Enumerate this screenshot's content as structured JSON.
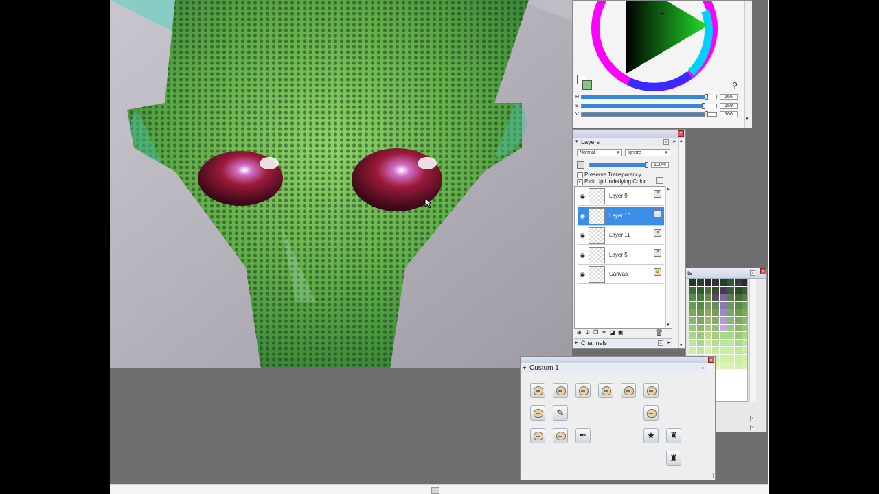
{
  "color_panel": {
    "labels": {
      "h": "H",
      "s": "S",
      "v": "V"
    },
    "values": {
      "h": "166",
      "s": "159",
      "v": "166"
    },
    "levels": {
      "h": 0.93,
      "s": 0.91,
      "v": 0.93
    },
    "primary_color": "#ffffff",
    "secondary_color": "#7fc97a"
  },
  "layers_panel": {
    "title": "Layers",
    "composite_method": "Normal",
    "composite_depth": "Ignore",
    "opacity": "100%",
    "opacity_level": 1.0,
    "preserve_transparency_label": "Preserve Transparency",
    "pick_up_color_label": "Pick Up Underlying Color",
    "preserve_transparency_checked": false,
    "pick_up_color_checked": true,
    "layers": [
      {
        "name": "Layer 9",
        "selected": false
      },
      {
        "name": "Layer 10",
        "selected": true
      },
      {
        "name": "Layer 11",
        "selected": false
      },
      {
        "name": "Layer 5",
        "selected": false
      },
      {
        "name": "Canvas",
        "selected": false
      }
    ],
    "channels_label": "Channels"
  },
  "swatches_panel": {
    "title_fragment": "ts",
    "colors": [
      "#1e3a24",
      "#22412b",
      "#2a2a2a",
      "#3b2a3a",
      "#25402a",
      "#2b5a35",
      "#3a3a3a",
      "#2a2a3a",
      "#3f6a3a",
      "#2f5a2f",
      "#4a6a3a",
      "#3a4a2a",
      "#4a3a5a",
      "#3a5a3a",
      "#2a4a2a",
      "#3a5a3a",
      "#5a8a4a",
      "#4a7a3a",
      "#6a8a4a",
      "#5a4a6a",
      "#7a6aa0",
      "#5a7a4a",
      "#4a6a3a",
      "#5a7a4a",
      "#6a9a4a",
      "#5a8a4a",
      "#7a9a5a",
      "#6a8a5a",
      "#8a7ab0",
      "#6a9a5a",
      "#5a8a4a",
      "#6a9a5a",
      "#7aa85a",
      "#6a9a4a",
      "#8aaa5a",
      "#7a9a5a",
      "#a08ac8",
      "#7aa85a",
      "#6a9a4a",
      "#7aa85a",
      "#8ab86a",
      "#7aa85a",
      "#9ab86a",
      "#8aaa6a",
      "#b09ad8",
      "#8ab86a",
      "#7aa85a",
      "#8ab86a",
      "#9ac87a",
      "#8ab86a",
      "#aac87a",
      "#9ab87a",
      "#c0aae0",
      "#9ac87a",
      "#8ab86a",
      "#9ac87a",
      "#aad88a",
      "#9ac87a",
      "#bad88a",
      "#aac88a",
      "#aad88a",
      "#aad88a",
      "#9ac87a",
      "#aad88a",
      "#bae89a",
      "#aad88a",
      "#c8e89a",
      "#bad89a",
      "#bae89a",
      "#bae89a",
      "#aad88a",
      "#bae89a",
      "#c8f0a0",
      "#bae89a",
      "#d0f0a8",
      "#c8e8a0",
      "#c8f0a0",
      "#c8f0a0",
      "#bae89a",
      "#c8f0a0",
      "#d0f0a8",
      "#c8f0a0",
      "#d8f4b0",
      "#d0f0a8",
      "#d0f0a8",
      "#d0f0a8",
      "#c8f0a0",
      "#d0f0a8",
      "#d8f4b0",
      "#d0f0a8",
      "#e0f8b8",
      "#d8f4b0",
      "#d8f4b0",
      "#d8f4b0",
      "#d0f0a8",
      "#d8f4b0"
    ]
  },
  "custom_palette": {
    "title": "Custom  1",
    "tools": [
      {
        "name": "brush-variant-1-icon",
        "glyph": ""
      },
      {
        "name": "brush-variant-2-icon",
        "glyph": ""
      },
      {
        "name": "brush-variant-3-icon",
        "glyph": ""
      },
      {
        "name": "brush-variant-4-icon",
        "glyph": ""
      },
      {
        "name": "brush-variant-5-icon",
        "glyph": ""
      },
      {
        "name": "brush-variant-6-icon",
        "glyph": ""
      },
      {
        "name": "brush-variant-7-icon",
        "glyph": ""
      },
      {
        "name": "pencil-icon",
        "glyph": "✎"
      },
      {
        "name": "brush-variant-8-icon",
        "glyph": ""
      },
      {
        "name": "brush-variant-9-icon",
        "glyph": ""
      },
      {
        "name": "brush-variant-10-icon",
        "glyph": ""
      },
      {
        "name": "airbrush-icon",
        "glyph": "✒"
      },
      {
        "name": "sparkle-icon",
        "glyph": "★"
      },
      {
        "name": "stamp-icon",
        "glyph": "♜"
      },
      {
        "name": "stamp-2-icon",
        "glyph": "♜"
      }
    ]
  }
}
